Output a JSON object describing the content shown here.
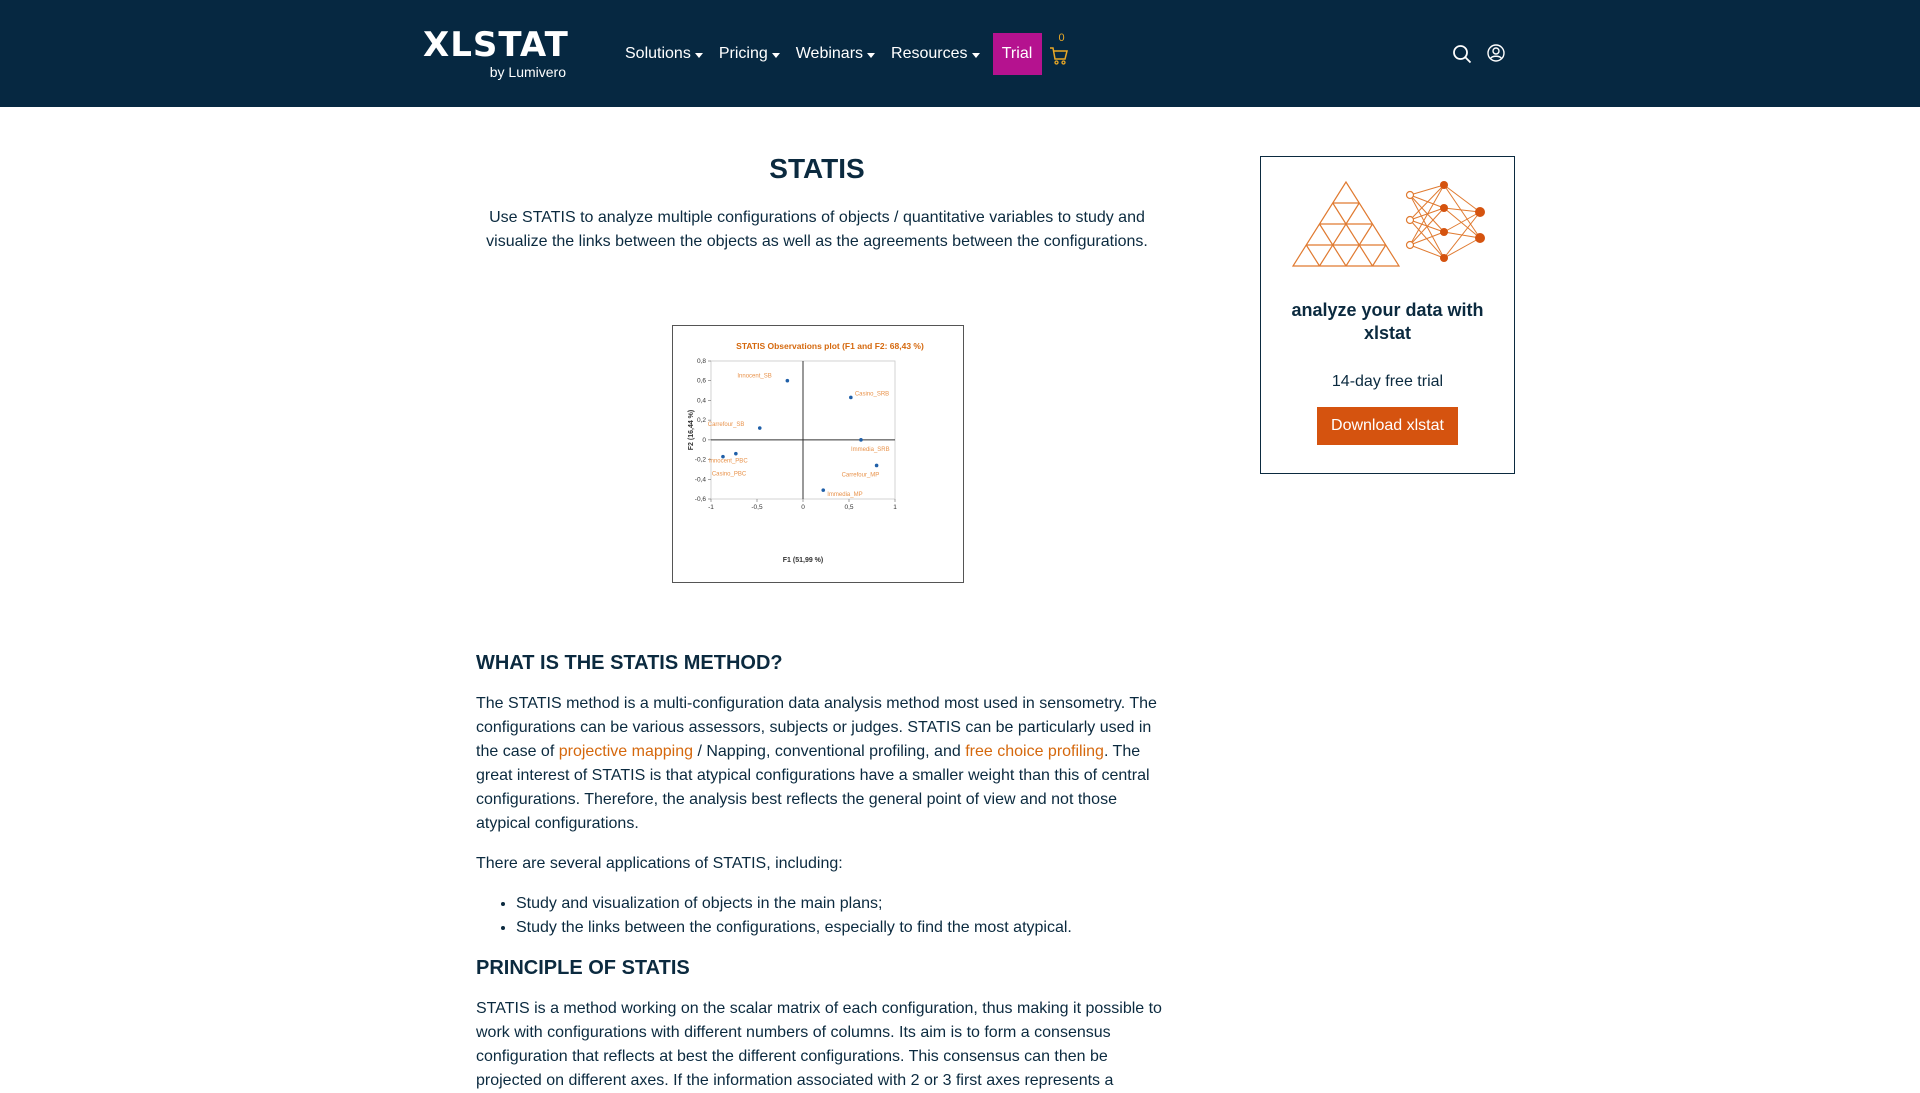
{
  "header": {
    "logo_main": "XLSTAT",
    "logo_sub": "by Lumivero",
    "nav": [
      {
        "label": "Solutions"
      },
      {
        "label": "Pricing"
      },
      {
        "label": "Webinars"
      },
      {
        "label": "Resources"
      }
    ],
    "trial_label": "Trial",
    "cart_count": "0",
    "icons": [
      "cart-icon",
      "search-icon",
      "user-icon"
    ]
  },
  "main": {
    "title": "STATIS",
    "intro": "Use STATIS to analyze multiple configurations of objects / quantitative variables to study and visualize the links between the objects as well as the agreements between the configurations.",
    "section1_heading": "WHAT IS THE STATIS METHOD?",
    "section1_p1_a": "The STATIS method is a multi-configuration data analysis method most used in sensometry. The configurations can be various assessors, subjects or judges. STATIS can be particularly used in the case of ",
    "section1_link1": "projective mapping",
    "section1_p1_b": " / Napping, conventional profiling, and ",
    "section1_link2": "free choice profiling",
    "section1_p1_c": ". The great interest of STATIS is that atypical configurations have a smaller weight than this of central configurations. Therefore, the analysis best reflects the general point of view and not those atypical configurations.",
    "section1_p2": "There are several applications of STATIS, including:",
    "bullets": [
      "Study and visualization of objects in the main plans;",
      "Study the links between the configurations, especially to find the most atypical."
    ],
    "section2_heading": "PRINCIPLE OF STATIS",
    "section2_p1": "STATIS is a method working on the scalar matrix of each configuration, thus making it possible to work with configurations with different numbers of columns. Its aim is to form a consensus configuration that reflects at best the different configurations. This consensus can then be projected on different axes. If the information associated with 2 or 3 first axes represents a"
  },
  "chart_data": {
    "type": "scatter",
    "title": "STATIS Observations plot (F1 and F2: 68,43 %)",
    "xlabel": "F1 (51,99 %)",
    "ylabel": "F2 (16,44 %)",
    "xlim": [
      -1,
      1
    ],
    "ylim": [
      -0.6,
      0.8
    ],
    "xticks": [
      "-1",
      "-0,5",
      "0",
      "0,5",
      "1"
    ],
    "yticks": [
      "0,8",
      "0,6",
      "0,4",
      "0,2",
      "0",
      "-0,2",
      "-0,4",
      "-0,6"
    ],
    "colors": {
      "point": "#1f5fa8",
      "label": "#e8924a",
      "title": "#d5680d"
    },
    "points": [
      {
        "label": "Innocent_SB",
        "x": -0.17,
        "y": 0.6
      },
      {
        "label": "Casino_SRB",
        "x": 0.52,
        "y": 0.43
      },
      {
        "label": "Carrefour_SB",
        "x": -0.47,
        "y": 0.12
      },
      {
        "label": "Immedia_SRB",
        "x": 0.63,
        "y": 0.0
      },
      {
        "label": "Innocent_PBC",
        "x": -0.87,
        "y": -0.17
      },
      {
        "label": "Casino_PBC",
        "x": -0.73,
        "y": -0.14
      },
      {
        "label": "Carrefour_MP",
        "x": 0.8,
        "y": -0.26
      },
      {
        "label": "Immedia_MP",
        "x": 0.22,
        "y": -0.51
      }
    ]
  },
  "sidebar": {
    "title": "analyze your data with xlstat",
    "trial_text": "14-day free trial",
    "button_label": "Download xlstat",
    "accent": "#d5530f"
  }
}
